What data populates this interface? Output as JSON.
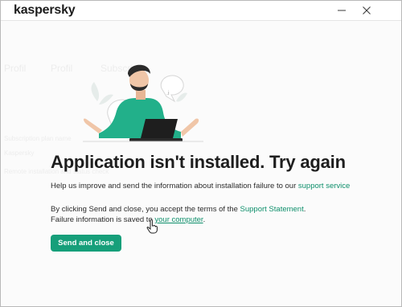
{
  "window": {
    "brand": "kaspersky",
    "minimize_icon": "minimize-icon",
    "close_icon": "close-icon"
  },
  "background_ghost_text": {
    "row1": [
      "Profil",
      "Profil",
      "Subscript"
    ],
    "row2": [
      "Subscription plan name",
      "Kaspersky"
    ],
    "row3": [
      "Remote installation and status check"
    ]
  },
  "illustration": {
    "icon": "person-with-laptop-illustration"
  },
  "content": {
    "headline": "Application isn't installed. Try again",
    "help_text": "Help us improve and send the information about installation failure to our ",
    "support_link": "support service",
    "terms_text_before": "By clicking Send and close, you accept the terms of the ",
    "support_statement_link": "Support Statement",
    "terms_text_after": ". Failure information is saved to ",
    "computer_link": "your computer",
    "terms_end": ".",
    "send_button": "Send and close"
  },
  "colors": {
    "accent": "#169f7a",
    "link": "#0e8f6b",
    "headline": "#1e1e1e"
  }
}
